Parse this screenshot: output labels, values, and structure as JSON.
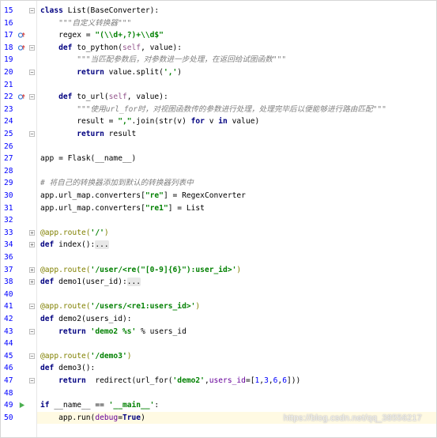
{
  "colors": {
    "keyword": "#000080",
    "string": "#008000",
    "comment": "#808080",
    "decorator": "#808000",
    "self_param": "#94558d",
    "keyword_arg": "#660099",
    "number": "#0000ff",
    "line_number": "#999999",
    "current_line": "#fffae3",
    "override_marker_blue": "#3a7bd5",
    "override_marker_red": "#d9534f",
    "run_marker": "#4caf50"
  },
  "lines": [
    {
      "num": "15",
      "marker": "",
      "fold": "minus",
      "tokens": [
        [
          "kw",
          "class"
        ],
        [
          "t",
          " List(BaseConverter):"
        ]
      ]
    },
    {
      "num": "16",
      "marker": "",
      "fold": "",
      "tokens": [
        [
          "t",
          "    "
        ],
        [
          "doc",
          "\"\"\"自定义转换器\"\"\""
        ]
      ]
    },
    {
      "num": "17",
      "marker": "override-up",
      "fold": "",
      "tokens": [
        [
          "t",
          "    regex = "
        ],
        [
          "str",
          "\"(\\\\d+,?)+\\\\d$\""
        ]
      ]
    },
    {
      "num": "18",
      "marker": "override-up",
      "fold": "minus",
      "tokens": [
        [
          "t",
          "    "
        ],
        [
          "kw",
          "def"
        ],
        [
          "t",
          " to_python("
        ],
        [
          "selfp",
          "self"
        ],
        [
          "t",
          ", value):"
        ]
      ]
    },
    {
      "num": "19",
      "marker": "",
      "fold": "",
      "tokens": [
        [
          "t",
          "        "
        ],
        [
          "doc",
          "\"\"\"当匹配参数后，对参数进一步处理，在返回给试图函数\"\"\""
        ]
      ]
    },
    {
      "num": "20",
      "marker": "",
      "fold": "minus",
      "tokens": [
        [
          "t",
          "        "
        ],
        [
          "kw",
          "return"
        ],
        [
          "t",
          " value.split("
        ],
        [
          "str",
          "','"
        ],
        [
          "t",
          ")"
        ]
      ]
    },
    {
      "num": "21",
      "marker": "",
      "fold": "",
      "tokens": []
    },
    {
      "num": "22",
      "marker": "override-up",
      "fold": "minus",
      "tokens": [
        [
          "t",
          "    "
        ],
        [
          "kw",
          "def"
        ],
        [
          "t",
          " to_url("
        ],
        [
          "selfp",
          "self"
        ],
        [
          "t",
          ", value):"
        ]
      ]
    },
    {
      "num": "23",
      "marker": "",
      "fold": "",
      "tokens": [
        [
          "t",
          "        "
        ],
        [
          "doc",
          "\"\"\"使用url_for时，对视图函数传的参数进行处理，处理完毕后以便能够进行路由匹配\"\"\""
        ]
      ]
    },
    {
      "num": "24",
      "marker": "",
      "fold": "",
      "tokens": [
        [
          "t",
          "        result = "
        ],
        [
          "str",
          "\",\""
        ],
        [
          "t",
          ".join(str(v) "
        ],
        [
          "kw",
          "for"
        ],
        [
          "t",
          " v "
        ],
        [
          "kw",
          "in"
        ],
        [
          "t",
          " value)"
        ]
      ]
    },
    {
      "num": "25",
      "marker": "",
      "fold": "minus",
      "tokens": [
        [
          "t",
          "        "
        ],
        [
          "kw",
          "return"
        ],
        [
          "t",
          " result"
        ]
      ]
    },
    {
      "num": "26",
      "marker": "",
      "fold": "",
      "tokens": []
    },
    {
      "num": "27",
      "marker": "",
      "fold": "",
      "tokens": [
        [
          "t",
          "app = Flask(__name__)"
        ]
      ]
    },
    {
      "num": "28",
      "marker": "",
      "fold": "",
      "tokens": []
    },
    {
      "num": "29",
      "marker": "",
      "fold": "",
      "tokens": [
        [
          "cmt",
          "# 将自己的转换器添加到默认的转换器列表中"
        ]
      ]
    },
    {
      "num": "30",
      "marker": "",
      "fold": "",
      "tokens": [
        [
          "t",
          "app.url_map.converters["
        ],
        [
          "str",
          "\"re\""
        ],
        [
          "t",
          "] = RegexConverter"
        ]
      ]
    },
    {
      "num": "31",
      "marker": "",
      "fold": "",
      "tokens": [
        [
          "t",
          "app.url_map.converters["
        ],
        [
          "str",
          "\"re1\""
        ],
        [
          "t",
          "] = List"
        ]
      ]
    },
    {
      "num": "32",
      "marker": "",
      "fold": "",
      "tokens": []
    },
    {
      "num": "33",
      "marker": "",
      "fold": "plus",
      "tokens": [
        [
          "dec",
          "@app.route("
        ],
        [
          "str",
          "'/'"
        ],
        [
          "dec",
          ")"
        ]
      ]
    },
    {
      "num": "34",
      "marker": "",
      "fold": "plus",
      "tokens": [
        [
          "kw",
          "def"
        ],
        [
          "t",
          " index():"
        ],
        [
          "fold-text",
          "..."
        ]
      ]
    },
    {
      "num": "36",
      "marker": "",
      "fold": "",
      "tokens": []
    },
    {
      "num": "37",
      "marker": "",
      "fold": "plus",
      "tokens": [
        [
          "dec",
          "@app.route("
        ],
        [
          "str",
          "'/user/<re(\"[0-9]{6}\"):user_id>'"
        ],
        [
          "dec",
          ")"
        ]
      ]
    },
    {
      "num": "38",
      "marker": "",
      "fold": "plus",
      "tokens": [
        [
          "kw",
          "def"
        ],
        [
          "t",
          " demo1(user_id):"
        ],
        [
          "fold-text",
          "..."
        ]
      ]
    },
    {
      "num": "40",
      "marker": "",
      "fold": "",
      "tokens": []
    },
    {
      "num": "41",
      "marker": "",
      "fold": "minus",
      "tokens": [
        [
          "dec",
          "@app.route("
        ],
        [
          "str",
          "'/users/<re1:users_id>'"
        ],
        [
          "dec",
          ")"
        ]
      ]
    },
    {
      "num": "42",
      "marker": "",
      "fold": "",
      "tokens": [
        [
          "kw",
          "def"
        ],
        [
          "t",
          " demo2(users_id):"
        ]
      ]
    },
    {
      "num": "43",
      "marker": "",
      "fold": "minus",
      "tokens": [
        [
          "t",
          "    "
        ],
        [
          "kw",
          "return"
        ],
        [
          "t",
          " "
        ],
        [
          "str",
          "'demo2 %s'"
        ],
        [
          "t",
          " % users_id"
        ]
      ]
    },
    {
      "num": "44",
      "marker": "",
      "fold": "",
      "tokens": []
    },
    {
      "num": "45",
      "marker": "",
      "fold": "minus",
      "tokens": [
        [
          "dec",
          "@app.route("
        ],
        [
          "str",
          "'/demo3'"
        ],
        [
          "dec",
          ")"
        ]
      ]
    },
    {
      "num": "46",
      "marker": "",
      "fold": "",
      "tokens": [
        [
          "kw",
          "def"
        ],
        [
          "t",
          " demo3():"
        ]
      ]
    },
    {
      "num": "47",
      "marker": "",
      "fold": "minus",
      "tokens": [
        [
          "t",
          "    "
        ],
        [
          "kw",
          "return"
        ],
        [
          "t",
          "  redirect(url_for("
        ],
        [
          "str",
          "'demo2'"
        ],
        [
          "t",
          ","
        ],
        [
          "kwarg",
          "users_id"
        ],
        [
          "t",
          "=["
        ],
        [
          "num",
          "1"
        ],
        [
          "t",
          ","
        ],
        [
          "num",
          "3"
        ],
        [
          "t",
          ","
        ],
        [
          "num",
          "6"
        ],
        [
          "t",
          ","
        ],
        [
          "num",
          "6"
        ],
        [
          "t",
          "]))"
        ]
      ]
    },
    {
      "num": "48",
      "marker": "",
      "fold": "",
      "tokens": []
    },
    {
      "num": "49",
      "marker": "run",
      "fold": "",
      "tokens": [
        [
          "kw",
          "if"
        ],
        [
          "t",
          " __name__ == "
        ],
        [
          "str",
          "'__main__'"
        ],
        [
          "t",
          ":"
        ]
      ]
    },
    {
      "num": "50",
      "marker": "",
      "fold": "",
      "tokens": [
        [
          "t",
          "    app.run("
        ],
        [
          "kwarg",
          "debug"
        ],
        [
          "t",
          "="
        ],
        [
          "kw",
          "True"
        ],
        [
          "t",
          ")"
        ]
      ],
      "current": true
    }
  ],
  "watermark": "https://blog.csdn.net/qq_38556217"
}
